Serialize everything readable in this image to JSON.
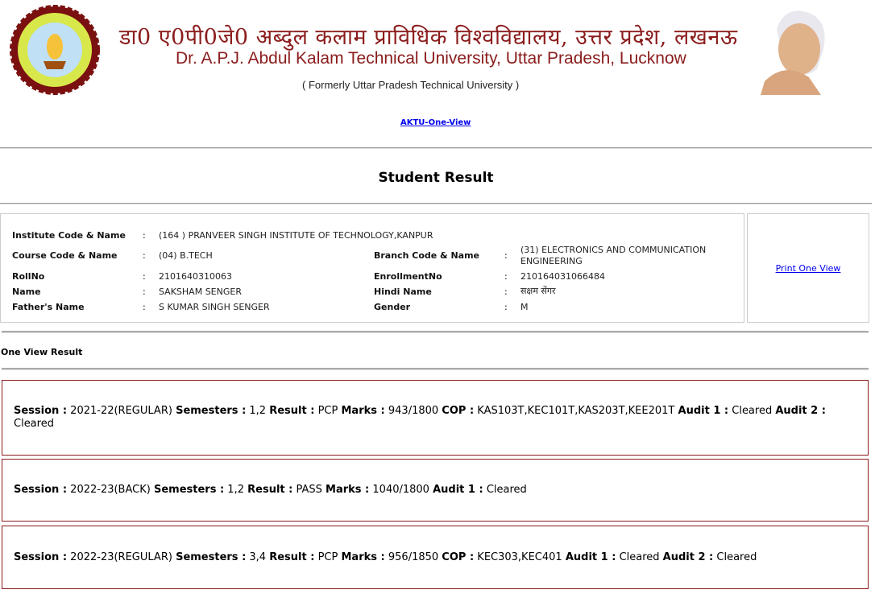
{
  "header": {
    "hindi_title": "डा0 ए0पी0जे0 अब्दुल कलाम प्राविधिक विश्वविद्यालय, उत्तर प्रदेश, लखनऊ",
    "english_title": "Dr. A.P.J. Abdul Kalam Technical University, Uttar Pradesh, Lucknow",
    "formerly": "( Formerly Uttar Pradesh Technical University )",
    "logo_text": "DR. A.P.J. ABDUL KALAM TECHNICAL UNIVERSITY, UTTAR PRADESH, LUCKNOW",
    "link": "AKTU-One-View"
  },
  "page_title": "Student Result",
  "student": {
    "institute_label": "Institute Code & Name",
    "institute": "(164 ) PRANVEER SINGH INSTITUTE OF TECHNOLOGY,KANPUR",
    "course_label": "Course Code & Name",
    "course": "(04) B.TECH",
    "branch_label": "Branch Code & Name",
    "branch": "(31) ELECTRONICS AND COMMUNICATION ENGINEERING",
    "roll_label": "RollNo",
    "roll": "2101640310063",
    "enroll_label": "EnrollmentNo",
    "enroll": "210164031066484",
    "name_label": "Name",
    "name": "SAKSHAM SENGER",
    "hindi_label": "Hindi Name",
    "hindi": "सक्षम सेंगर",
    "father_label": "Father's Name",
    "father": "S KUMAR SINGH SENGER",
    "gender_label": "Gender",
    "gender": "M",
    "colon": ":"
  },
  "print_link": "Print One View",
  "section_title": "One View Result",
  "labels": {
    "session": "Session :",
    "semesters": "Semesters :",
    "result": "Result :",
    "marks": "Marks :",
    "cop": "COP :",
    "audit1": "Audit 1 :",
    "audit2": "Audit 2 :"
  },
  "sessions": [
    {
      "session": "2021-22(REGULAR)",
      "semesters": "1,2",
      "result": "PCP",
      "marks": "943/1800",
      "cop": "KAS103T,KEC101T,KAS203T,KEE201T",
      "audit1": "Cleared",
      "audit2": "Cleared"
    },
    {
      "session": "2022-23(BACK)",
      "semesters": "1,2",
      "result": "PASS",
      "marks": "1040/1800",
      "audit1": "Cleared"
    },
    {
      "session": "2022-23(REGULAR)",
      "semesters": "3,4",
      "result": "PCP",
      "marks": "956/1850",
      "cop": "KEC303,KEC401",
      "audit1": "Cleared",
      "audit2": "Cleared"
    }
  ]
}
